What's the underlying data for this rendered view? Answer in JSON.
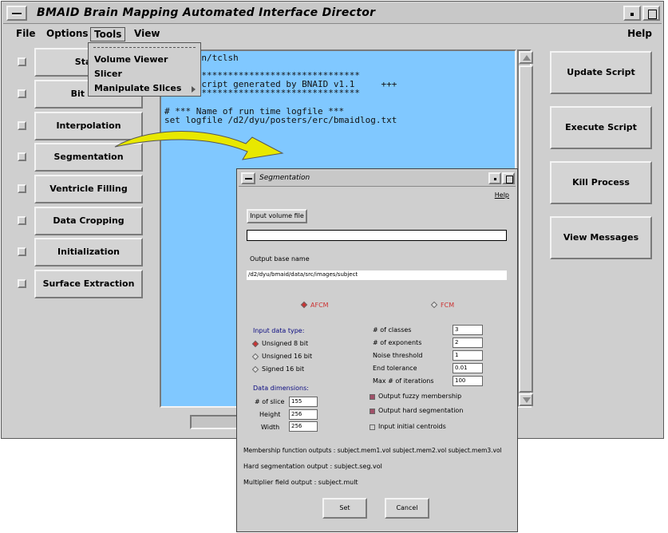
{
  "app": {
    "title": "BMAID    Brain Mapping Automated Interface Director"
  },
  "menubar": {
    "file": "File",
    "options": "Options",
    "tools": "Tools",
    "view": "View",
    "help": "Help"
  },
  "tools_menu": {
    "items": [
      "Volume Viewer",
      "Slicer",
      "Manipulate Slices"
    ]
  },
  "modules": [
    {
      "label": "Stack"
    },
    {
      "label": "Bit Con"
    },
    {
      "label": "Interpolation"
    },
    {
      "label": "Segmentation"
    },
    {
      "label": "Ventricle Filling"
    },
    {
      "label": "Data Cropping"
    },
    {
      "label": "Initialization"
    },
    {
      "label": "Surface Extraction"
    }
  ],
  "script": {
    "lines": [
      "ocal/bin/tclsh",
      "",
      "*************************************",
      "      Script generated by BNAID v1.1     +++",
      "*************************************",
      "",
      "# *** Name of run time logfile ***",
      "set logfile /d2/dyu/posters/erc/bmaidlog.txt"
    ]
  },
  "actions": {
    "update": "Update Script",
    "execute": "Execute Script",
    "kill": "Kill Process",
    "view_messages": "View Messages"
  },
  "segmentation": {
    "title": "Segmentation",
    "help": "Help",
    "input_button": "Input volume file",
    "input_value": "",
    "output_base_label": "Output base name",
    "output_base_value": "/d2/dyu/bmaid/data/src/images/subject",
    "method_afcm": "AFCM",
    "method_fcm": "FCM",
    "input_type_title": "Input data type:",
    "input_types": [
      "Unsigned 8 bit",
      "Unsigned 16 bit",
      "Signed 16 bit"
    ],
    "dims_title": "Data dimensions:",
    "dims": [
      {
        "label": "# of slice",
        "value": "155"
      },
      {
        "label": "Height",
        "value": "256"
      },
      {
        "label": "Width",
        "value": "256"
      }
    ],
    "params": [
      {
        "label": "# of classes",
        "value": "3"
      },
      {
        "label": "# of exponents",
        "value": "2"
      },
      {
        "label": "Noise threshold",
        "value": "1"
      },
      {
        "label": "End tolerance",
        "value": "0.01"
      },
      {
        "label": "Max # of iterations",
        "value": "100"
      }
    ],
    "checks": [
      {
        "label": "Output fuzzy membership",
        "checked": true
      },
      {
        "label": "Output hard segmentation",
        "checked": true
      },
      {
        "label": "Input initial centroids",
        "checked": false
      }
    ],
    "membership_outputs": "Membership function outputs : subject.mem1.vol subject.mem2.vol subject.mem3.vol",
    "hard_output": "Hard segmentation output : subject.seg.vol",
    "multiplier_output": "Multiplier field output : subject.mult",
    "set_button": "Set",
    "cancel_button": "Cancel"
  },
  "colors": {
    "script_bg": "#80c8ff",
    "arrow_yellow": "#e8e800",
    "radio_selected": "#cc3333",
    "check_selected": "#a05068"
  }
}
